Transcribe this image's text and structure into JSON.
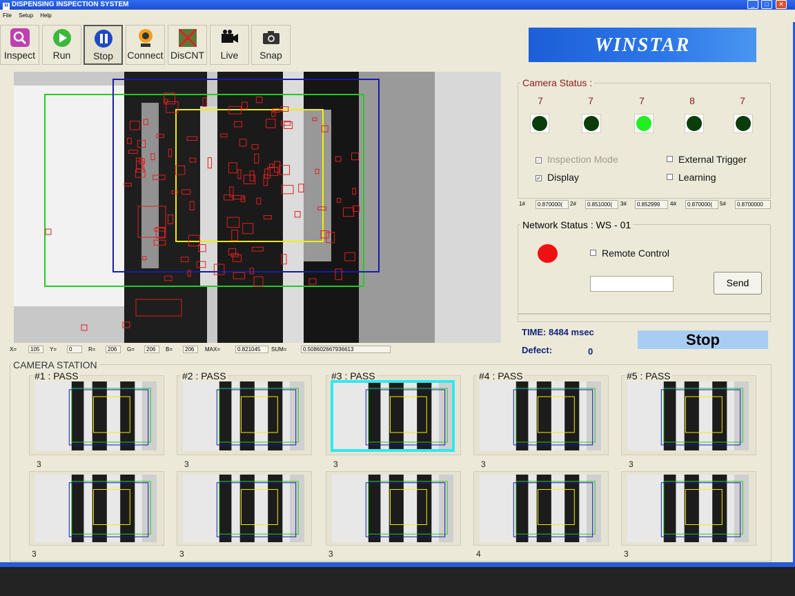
{
  "window": {
    "title": "DISPENSING INSPECTION SYSTEM",
    "icon_text": "H"
  },
  "menu": [
    "File",
    "Setup",
    "Help"
  ],
  "toolbar": {
    "inspect": "Inspect",
    "run": "Run",
    "stop": "Stop",
    "connect": "Connect",
    "discnt": "DisCNT",
    "live": "Live",
    "snap": "Snap"
  },
  "logo": "WINSTAR",
  "readout": {
    "x_label": "X=",
    "x": "105",
    "y_label": "Y=",
    "y": "0",
    "r_label": "R=",
    "r": "206",
    "g_label": "G=",
    "g": "206",
    "b_label": "B=",
    "b": "206",
    "max_label": "MAX=",
    "max": "0.821045",
    "sum_label": "SUM=",
    "sum": "0.508602667936613"
  },
  "camera_status": {
    "title": "Camera Status :",
    "cameras": [
      {
        "count": "7",
        "active": false
      },
      {
        "count": "7",
        "active": false
      },
      {
        "count": "7",
        "active": true
      },
      {
        "count": "8",
        "active": false
      },
      {
        "count": "7",
        "active": false
      }
    ],
    "inspection_mode": "Inspection Mode",
    "display": "Display",
    "external_trigger": "External Trigger",
    "learning": "Learning",
    "scores": [
      {
        "label": "1#",
        "value": "0.870000("
      },
      {
        "label": "2#",
        "value": "0.851000("
      },
      {
        "label": "3#",
        "value": "0.852999"
      },
      {
        "label": "4#",
        "value": "0.870000("
      },
      {
        "label": "5#",
        "value": "0.8700000"
      }
    ]
  },
  "network": {
    "title": "Network Status :  WS - 01",
    "remote_control": "Remote Control",
    "input_value": "",
    "send": "Send"
  },
  "time": "TIME: 8484 msec",
  "defect_label": "Defect:",
  "defect_value": "0",
  "run_status": "Stop",
  "camera_station": {
    "title": "CAMERA STATION",
    "top": [
      {
        "title": "#1 : PASS",
        "count": "3"
      },
      {
        "title": "#2 : PASS",
        "count": "3"
      },
      {
        "title": "#3 : PASS",
        "count": "3"
      },
      {
        "title": "#4 : PASS",
        "count": "3"
      },
      {
        "title": "#5 : PASS",
        "count": "3"
      }
    ],
    "bottom": [
      {
        "count": "3"
      },
      {
        "count": "3"
      },
      {
        "count": "3"
      },
      {
        "count": "4"
      },
      {
        "count": "3"
      }
    ]
  },
  "colors": {
    "roi_green": "#22cc22",
    "roi_blue": "#1a1aa8",
    "roi_yellow": "#f0f000",
    "defect_red": "#e02020",
    "led_on": "#22ee22",
    "led_off": "#0a3d0a",
    "network_led": "#ee1111"
  }
}
